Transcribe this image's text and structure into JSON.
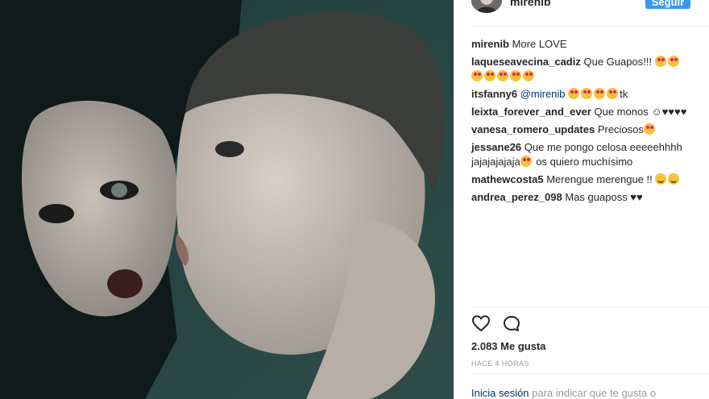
{
  "post": {
    "author": "mirenib",
    "follow_label": "Seguir",
    "likes": "2.083 Me gusta",
    "time": "HACE 4 HORAS",
    "login_link": "Inicia sesión",
    "login_text": " para indicar que te gusta o"
  },
  "comments": [
    {
      "user": "mirenib",
      "text": "More LOVE",
      "emojis": []
    },
    {
      "user": "laqueseavecina_cadiz",
      "text": "Que Guapos!!! ",
      "emojis": [
        "heart-eyes",
        "heart-eyes",
        "heart-eyes",
        "heart-eyes",
        "heart-eyes",
        "heart-eyes",
        "heart-eyes"
      ],
      "suffix": ""
    },
    {
      "user": "itsfanny6",
      "mention": "@mirenib",
      "text": " ",
      "emojis": [
        "heart-eyes",
        "heart-eyes",
        "heart-eyes",
        "heart-eyes"
      ],
      "suffix": "tk"
    },
    {
      "user": "leixta_forever_and_ever",
      "text": "Que monos ☺♥♥♥♥",
      "emojis": []
    },
    {
      "user": "vanesa_romero_updates",
      "text": "Preciosos",
      "emojis": [
        "heart-eyes"
      ]
    },
    {
      "user": "jessane26",
      "text": "Que me pongo celosa eeeeehhhh jajajajajaja",
      "emojis": [
        "heart-eyes"
      ],
      "suffix": " os quiero muchísimo"
    },
    {
      "user": "mathewcosta5",
      "text": "Merengue merengue !! ",
      "emojis": [
        "smile",
        "smile"
      ]
    },
    {
      "user": "andrea_perez_098",
      "text": "Mas guaposs ♥♥",
      "emojis": []
    }
  ],
  "icons": {
    "like": "heart-outline-icon",
    "comment": "comment-bubble-icon"
  },
  "colors": {
    "follow_button": "#3897f0",
    "link": "#003569",
    "muted": "#999999"
  }
}
